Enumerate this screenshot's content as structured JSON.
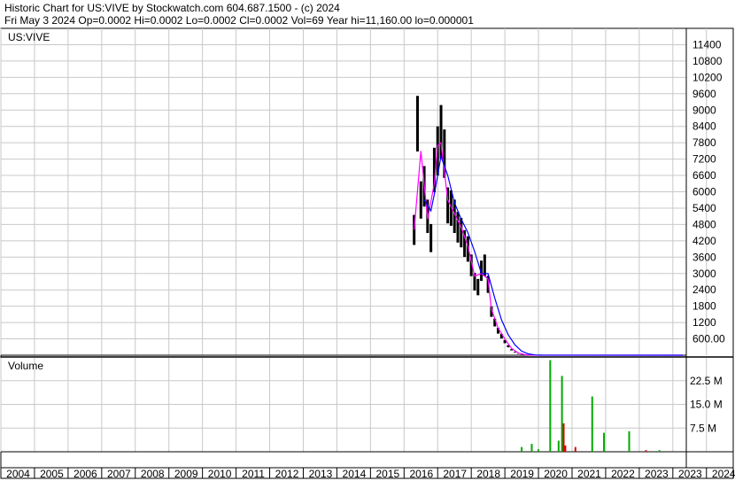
{
  "header": {
    "line1": "Historic Chart for US:VIVE by Stockwatch.com 604.687.1500 - (c) 2024",
    "line2": "Fri May  3 2024   Op=0.0002   Hi=0.0002   Lo=0.0002   Cl=0.0002   Vol=69   Year hi=11,160.00   lo=0.000001"
  },
  "price_panel": {
    "label": "US:VIVE"
  },
  "volume_panel": {
    "label": "Volume"
  },
  "colors": {
    "grid": "#c8c8c8",
    "price_bar": "#000000",
    "ma_short": "#ff00ff",
    "ma_long": "#0000ff",
    "vol_up": "#00aa00",
    "vol_down": "#dd0000"
  },
  "chart_data": [
    {
      "type": "line",
      "name": "US:VIVE price",
      "y_ticks": [
        "11400",
        "10800",
        "10200",
        "9600",
        "9000",
        "8400",
        "7800",
        "7200",
        "6600",
        "6000",
        "5400",
        "4800",
        "4200",
        "3600",
        "3000",
        "2400",
        "1800",
        "1200",
        "600.00"
      ],
      "ylim": [
        0,
        12000
      ],
      "x_ticks": [
        "2004",
        "2005",
        "2006",
        "2007",
        "2008",
        "2009",
        "2010",
        "2011",
        "2012",
        "2013",
        "2014",
        "2015",
        "2016",
        "2017",
        "2018",
        "2019",
        "2020",
        "2021",
        "2022",
        "2023",
        "2023",
        "2024"
      ],
      "xlim": [
        2004.0,
        2024.4
      ],
      "grid": true,
      "series": [
        {
          "style": "hlc-bars",
          "x": [
            2016.3,
            2016.4,
            2016.5,
            2016.6,
            2016.7,
            2016.8,
            2016.9,
            2017.0,
            2017.1,
            2017.2,
            2017.3,
            2017.4,
            2017.5,
            2017.6,
            2017.7,
            2017.8,
            2017.9,
            2018.0,
            2018.1,
            2018.2,
            2018.3,
            2018.4,
            2018.5,
            2018.6,
            2018.7,
            2018.8,
            2018.9,
            2019.0,
            2019.1,
            2019.2,
            2019.3,
            2019.4,
            2019.5,
            2019.6,
            2019.7,
            2019.8,
            2019.9,
            2020.0,
            2024.3
          ],
          "values": [
            4600,
            8500,
            5700,
            6200,
            5100,
            4300,
            6800,
            7500,
            8200,
            7400,
            5500,
            5400,
            5100,
            4700,
            4500,
            4100,
            3900,
            3300,
            2700,
            2500,
            3100,
            3300,
            2600,
            1600,
            1200,
            900,
            700,
            500,
            330,
            200,
            110,
            60,
            30,
            15,
            8,
            5,
            3,
            1,
            0.0002
          ]
        },
        {
          "name": "",
          "x": [
            2016.3,
            2016.5,
            2016.7,
            2016.9,
            2017.0,
            2017.1,
            2017.3,
            2017.5,
            2017.7,
            2017.9,
            2018.1,
            2018.3,
            2018.5,
            2018.6,
            2018.8,
            2019.0,
            2019.2,
            2019.4,
            2019.6,
            2019.8,
            2020.0,
            2024.3
          ],
          "values": [
            4600,
            7500,
            5000,
            6300,
            7700,
            7800,
            5700,
            5200,
            4700,
            4000,
            2900,
            3000,
            2800,
            1700,
            1000,
            600,
            250,
            80,
            20,
            6,
            1,
            0.0002
          ]
        },
        {
          "name": "",
          "x": [
            2016.6,
            2016.8,
            2016.9,
            2017.1,
            2017.3,
            2017.5,
            2017.7,
            2017.9,
            2018.1,
            2018.3,
            2018.5,
            2018.7,
            2018.9,
            2019.1,
            2019.3,
            2019.5,
            2019.7,
            2019.9,
            2020.1,
            2024.3
          ],
          "values": [
            5700,
            5300,
            5900,
            7300,
            6600,
            5600,
            5000,
            4500,
            3800,
            3000,
            3000,
            2100,
            1300,
            750,
            380,
            150,
            50,
            10,
            2,
            0.0002
          ]
        }
      ]
    },
    {
      "type": "bar",
      "name": "Volume",
      "y_ticks": [
        "22.5 M",
        "15.0 M",
        "7.5 M"
      ],
      "ylim": [
        0,
        30
      ],
      "grid": true,
      "series": [
        {
          "name": "",
          "x": [
            2019.5,
            2019.8,
            2020.0,
            2020.35,
            2020.6,
            2020.7,
            2020.75,
            2020.8,
            2021.1,
            2021.6,
            2021.95,
            2022.7,
            2023.2,
            2023.6
          ],
          "values": [
            1.5,
            2.5,
            0.8,
            29.0,
            3.5,
            24.0,
            9.0,
            2.0,
            1.5,
            17.5,
            6.0,
            6.5,
            0.5,
            0.5
          ],
          "up": [
            true,
            true,
            true,
            true,
            true,
            true,
            false,
            false,
            false,
            true,
            true,
            true,
            false,
            true
          ]
        }
      ]
    }
  ]
}
